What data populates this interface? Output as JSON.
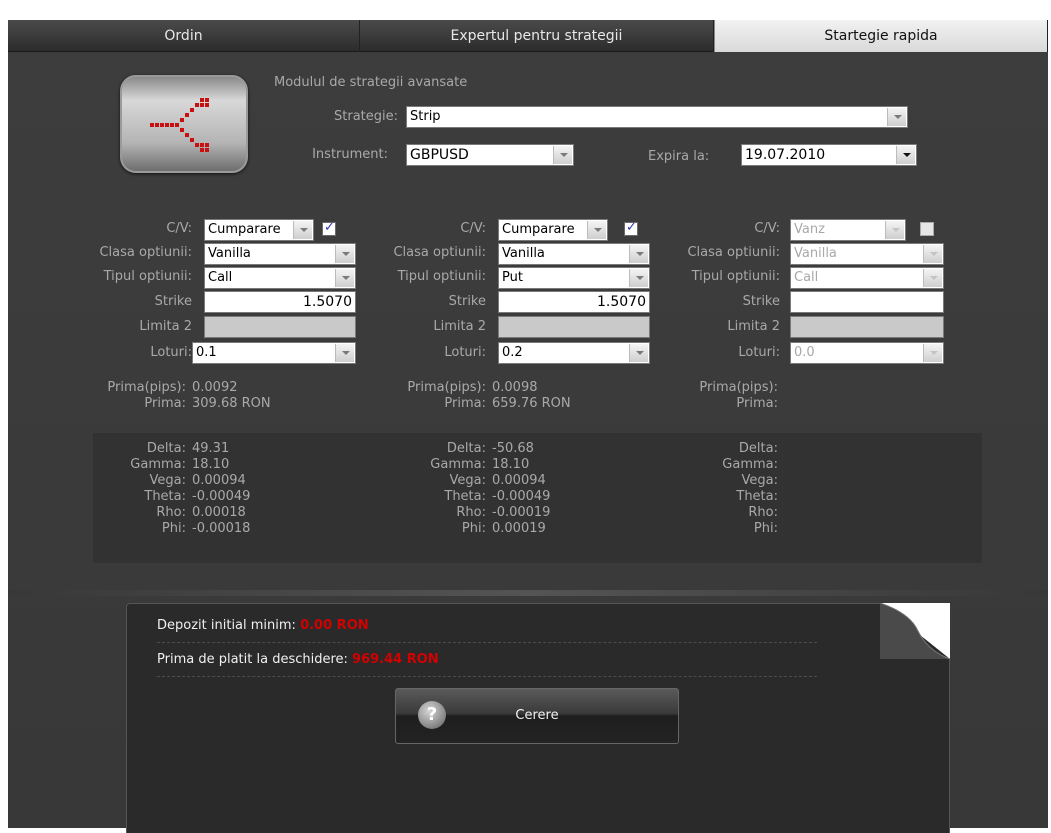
{
  "tabs": [
    {
      "label": "Ordin",
      "active": false
    },
    {
      "label": "Expertul pentru strategii",
      "active": false
    },
    {
      "label": "Startegie rapida",
      "active": true
    }
  ],
  "module_title": "Modulul de strategii avansate",
  "strategy": {
    "label": "Strategie:",
    "value": "Strip"
  },
  "instrument": {
    "label": "Instrument:",
    "value": "GBPUSD"
  },
  "expiry": {
    "label": "Expira la:",
    "value": "19.07.2010"
  },
  "field_labels": {
    "cv": "C/V:",
    "option_class": "Clasa optiunii:",
    "option_type": "Tipul optiunii:",
    "strike": "Strike",
    "limit2": "Limita 2",
    "lots": "Loturi:",
    "prima_pips": "Prima(pips):",
    "prima": "Prima:",
    "delta": "Delta:",
    "gamma": "Gamma:",
    "vega": "Vega:",
    "theta": "Theta:",
    "rho": "Rho:",
    "phi": "Phi:"
  },
  "legs": [
    {
      "cv": "Cumparare",
      "checked": true,
      "enabled": true,
      "option_class": "Vanilla",
      "option_type": "Call",
      "strike": "1.5070",
      "limit2": "",
      "lots": "0.1",
      "prima_pips": "0.0092",
      "prima": "309.68 RON",
      "delta": "49.31",
      "gamma": "18.10",
      "vega": "0.00094",
      "theta": "-0.00049",
      "rho": "0.00018",
      "phi": "-0.00018"
    },
    {
      "cv": "Cumparare",
      "checked": true,
      "enabled": true,
      "option_class": "Vanilla",
      "option_type": "Put",
      "strike": "1.5070",
      "limit2": "",
      "lots": "0.2",
      "prima_pips": "0.0098",
      "prima": "659.76 RON",
      "delta": "-50.68",
      "gamma": "18.10",
      "vega": "0.00094",
      "theta": "-0.00049",
      "rho": "-0.00019",
      "phi": "0.00019"
    },
    {
      "cv": "Vanz",
      "checked": false,
      "enabled": false,
      "option_class": "Vanilla",
      "option_type": "Call",
      "strike": "",
      "limit2": "",
      "lots": "0.0",
      "prima_pips": "",
      "prima": "",
      "delta": "",
      "gamma": "",
      "vega": "",
      "theta": "",
      "rho": "",
      "phi": ""
    }
  ],
  "summary": {
    "min_deposit_label": "Depozit initial minim:",
    "min_deposit_value": "0.00 RON",
    "premium_label": "Prima de platit la deschidere:",
    "premium_value": "969.44 RON"
  },
  "request_button": {
    "label": "Cerere",
    "icon": "help-icon"
  },
  "colors": {
    "background": "#3c3c3c",
    "accent_red": "#d40000",
    "active_tab": "#e6e6e6"
  }
}
